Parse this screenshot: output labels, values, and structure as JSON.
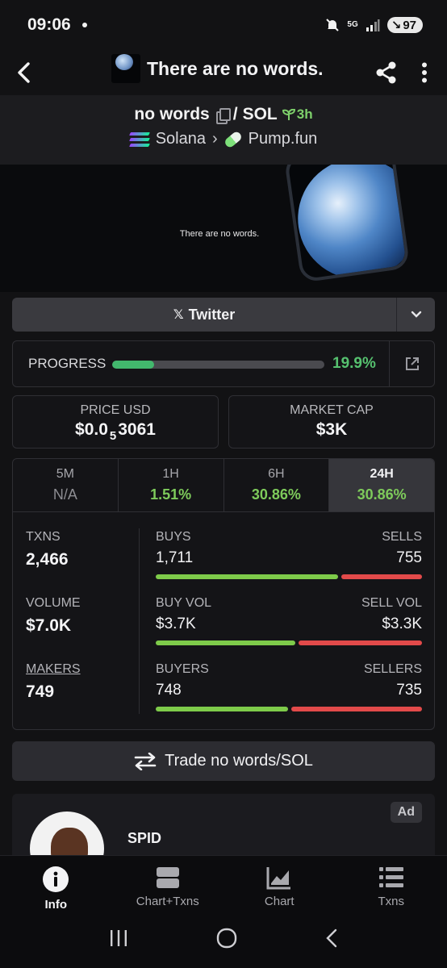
{
  "status_bar": {
    "time": "09:06",
    "network": "5G",
    "battery": "97"
  },
  "app_bar": {
    "title": "There are no words."
  },
  "pair": {
    "base": "no words",
    "separator": "/",
    "quote": "SOL",
    "age": "3h",
    "chain": "Solana",
    "dex": "Pump.fun"
  },
  "banner": {
    "text": "There are no words."
  },
  "social": {
    "label": "Twitter"
  },
  "progress": {
    "label": "PROGRESS",
    "value_text": "19.9%",
    "fraction": 0.199
  },
  "price": {
    "label": "PRICE USD",
    "prefix": "$0.0",
    "zeros": "5",
    "suffix": "3061"
  },
  "market_cap": {
    "label": "MARKET CAP",
    "value": "$3K"
  },
  "timeframes": [
    {
      "name": "5M",
      "change": "N/A"
    },
    {
      "name": "1H",
      "change": "1.51%"
    },
    {
      "name": "6H",
      "change": "30.86%"
    },
    {
      "name": "24H",
      "change": "30.86%"
    }
  ],
  "active_timeframe": "24H",
  "stats": {
    "txns": {
      "label": "TXNS",
      "value": "2,466"
    },
    "volume": {
      "label": "VOLUME",
      "value": "$7.0K"
    },
    "makers": {
      "label": "MAKERS",
      "value": "749"
    },
    "buys": {
      "label": "BUYS",
      "value": "1,711",
      "sell_label": "SELLS",
      "sell_value": "755",
      "buy_fraction": 0.694
    },
    "buy_vol": {
      "label": "BUY VOL",
      "value": "$3.7K",
      "sell_label": "SELL VOL",
      "sell_value": "$3.3K",
      "buy_fraction": 0.53
    },
    "buyers": {
      "label": "BUYERS",
      "value": "748",
      "sell_label": "SELLERS",
      "sell_value": "735",
      "buy_fraction": 0.504
    }
  },
  "trade_button": {
    "label": "Trade no words/SOL"
  },
  "ad": {
    "badge": "Ad",
    "name": "SPID"
  },
  "bottom_nav": [
    {
      "label": "Info",
      "icon": "info-icon"
    },
    {
      "label": "Chart+Txns",
      "icon": "chart-txns-icon"
    },
    {
      "label": "Chart",
      "icon": "chart-icon"
    },
    {
      "label": "Txns",
      "icon": "list-icon"
    }
  ],
  "colors": {
    "green": "#7ecb4a",
    "red": "#e24a4a",
    "accent_green": "#42b86d"
  }
}
